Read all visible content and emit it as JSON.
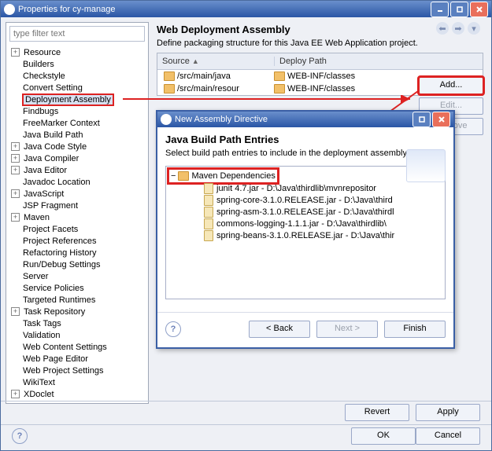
{
  "main_title": "Properties for cy-manage",
  "filter_placeholder": "type filter text",
  "tree": [
    {
      "label": "Resource",
      "tw": "+",
      "indent": false
    },
    {
      "label": "Builders",
      "indent": true
    },
    {
      "label": "Checkstyle",
      "indent": true
    },
    {
      "label": "Convert Setting",
      "indent": true
    },
    {
      "label": "Deployment Assembly",
      "indent": true,
      "selected": true
    },
    {
      "label": "Findbugs",
      "indent": true
    },
    {
      "label": "FreeMarker Context",
      "indent": true
    },
    {
      "label": "Java Build Path",
      "indent": true
    },
    {
      "label": "Java Code Style",
      "tw": "+",
      "indent": false
    },
    {
      "label": "Java Compiler",
      "tw": "+",
      "indent": false
    },
    {
      "label": "Java Editor",
      "tw": "+",
      "indent": false
    },
    {
      "label": "Javadoc Location",
      "indent": true
    },
    {
      "label": "JavaScript",
      "tw": "+",
      "indent": false
    },
    {
      "label": "JSP Fragment",
      "indent": true
    },
    {
      "label": "Maven",
      "tw": "+",
      "indent": false
    },
    {
      "label": "Project Facets",
      "indent": true
    },
    {
      "label": "Project References",
      "indent": true
    },
    {
      "label": "Refactoring History",
      "indent": true
    },
    {
      "label": "Run/Debug Settings",
      "indent": true
    },
    {
      "label": "Server",
      "indent": true
    },
    {
      "label": "Service Policies",
      "indent": true
    },
    {
      "label": "Targeted Runtimes",
      "indent": true
    },
    {
      "label": "Task Repository",
      "tw": "+",
      "indent": false
    },
    {
      "label": "Task Tags",
      "indent": true
    },
    {
      "label": "Validation",
      "indent": true
    },
    {
      "label": "Web Content Settings",
      "indent": true
    },
    {
      "label": "Web Page Editor",
      "indent": true
    },
    {
      "label": "Web Project Settings",
      "indent": true
    },
    {
      "label": "WikiText",
      "indent": true
    },
    {
      "label": "XDoclet",
      "tw": "+",
      "indent": false
    }
  ],
  "right": {
    "title": "Web Deployment Assembly",
    "desc": "Define packaging structure for this Java EE Web Application project.",
    "col_source": "Source",
    "col_deploy": "Deploy Path",
    "rows": [
      {
        "src": "/src/main/java",
        "dep": "WEB-INF/classes"
      },
      {
        "src": "/src/main/resour",
        "dep": "WEB-INF/classes"
      }
    ],
    "btn_add": "Add...",
    "btn_edit": "Edit...",
    "btn_remove": "Remove",
    "btn_revert": "Revert",
    "btn_apply": "Apply"
  },
  "footer": {
    "ok": "OK",
    "cancel": "Cancel"
  },
  "dialog": {
    "title": "New Assembly Directive",
    "heading": "Java Build Path Entries",
    "desc": "Select build path entries to include in the deployment assembly.",
    "root": "Maven Dependencies",
    "children": [
      "junit 4.7.jar - D:\\Java\\thirdlib\\mvnrepositor",
      "spring-core-3.1.0.RELEASE.jar - D:\\Java\\third",
      "spring-asm-3.1.0.RELEASE.jar - D:\\Java\\thirdl",
      "commons-logging-1.1.1.jar - D:\\Java\\thirdlib\\",
      "spring-beans-3.1.0.RELEASE.jar - D:\\Java\\thir"
    ],
    "btn_back": "< Back",
    "btn_next": "Next >",
    "btn_finish": "Finish"
  }
}
